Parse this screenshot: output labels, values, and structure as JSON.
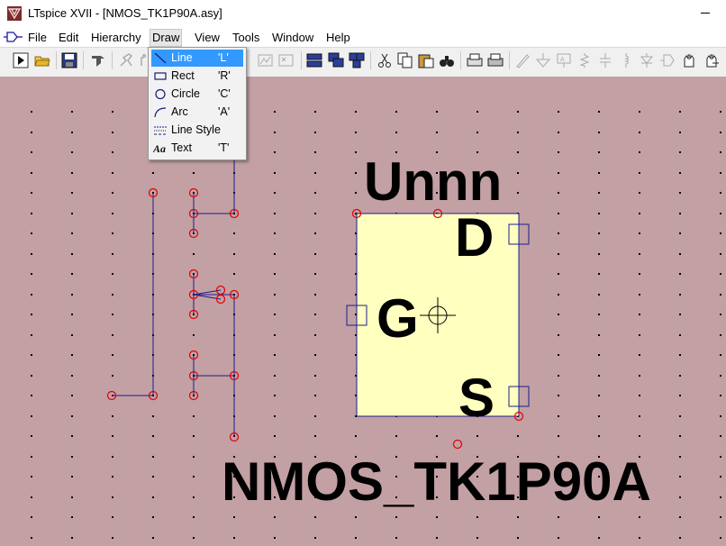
{
  "window": {
    "title": "LTspice XVII - [NMOS_TK1P90A.asy]"
  },
  "menubar": {
    "items": [
      "File",
      "Edit",
      "Hierarchy",
      "Draw",
      "View",
      "Tools",
      "Window",
      "Help"
    ],
    "active": "Draw"
  },
  "toolbar": {
    "icons": [
      "run-icon",
      "open-icon",
      "save-icon",
      "control-panel-icon",
      "halt-icon",
      "pan-icon",
      "zoom-full-icon",
      "zoom-out-icon",
      "tile-vertical-icon",
      "cascade-icon",
      "tile-icon",
      "cut-icon",
      "copy-icon",
      "paste-icon",
      "find-icon",
      "print-preview-icon",
      "print-icon",
      "wire-icon",
      "ground-icon",
      "label-icon",
      "resistor-icon",
      "capacitor-icon",
      "inductor-icon",
      "diode-icon",
      "component-icon",
      "move-icon",
      "drag-icon"
    ]
  },
  "draw_menu": {
    "items": [
      {
        "label": "Line",
        "shortcut": "'L'",
        "icon": "line-icon"
      },
      {
        "label": "Rect",
        "shortcut": "'R'",
        "icon": "rect-icon"
      },
      {
        "label": "Circle",
        "shortcut": "'C'",
        "icon": "circle-icon"
      },
      {
        "label": "Arc",
        "shortcut": "'A'",
        "icon": "arc-icon"
      },
      {
        "label": "Line Style",
        "shortcut": "",
        "icon": "line-style-icon"
      },
      {
        "label": "Text",
        "shortcut": "'T'",
        "icon": "text-icon"
      }
    ],
    "highlighted": "Line"
  },
  "symbol": {
    "value_label": "Unnn",
    "name_label": "NMOS_TK1P90A",
    "pin_d": "D",
    "pin_g": "G",
    "pin_s": "S"
  },
  "colors": {
    "canvas": "#c2a0a4",
    "body_fill": "#ffffc0",
    "line": "#1c1c8c",
    "handle": "#e00000",
    "menu_highlight": "#3399ff"
  }
}
